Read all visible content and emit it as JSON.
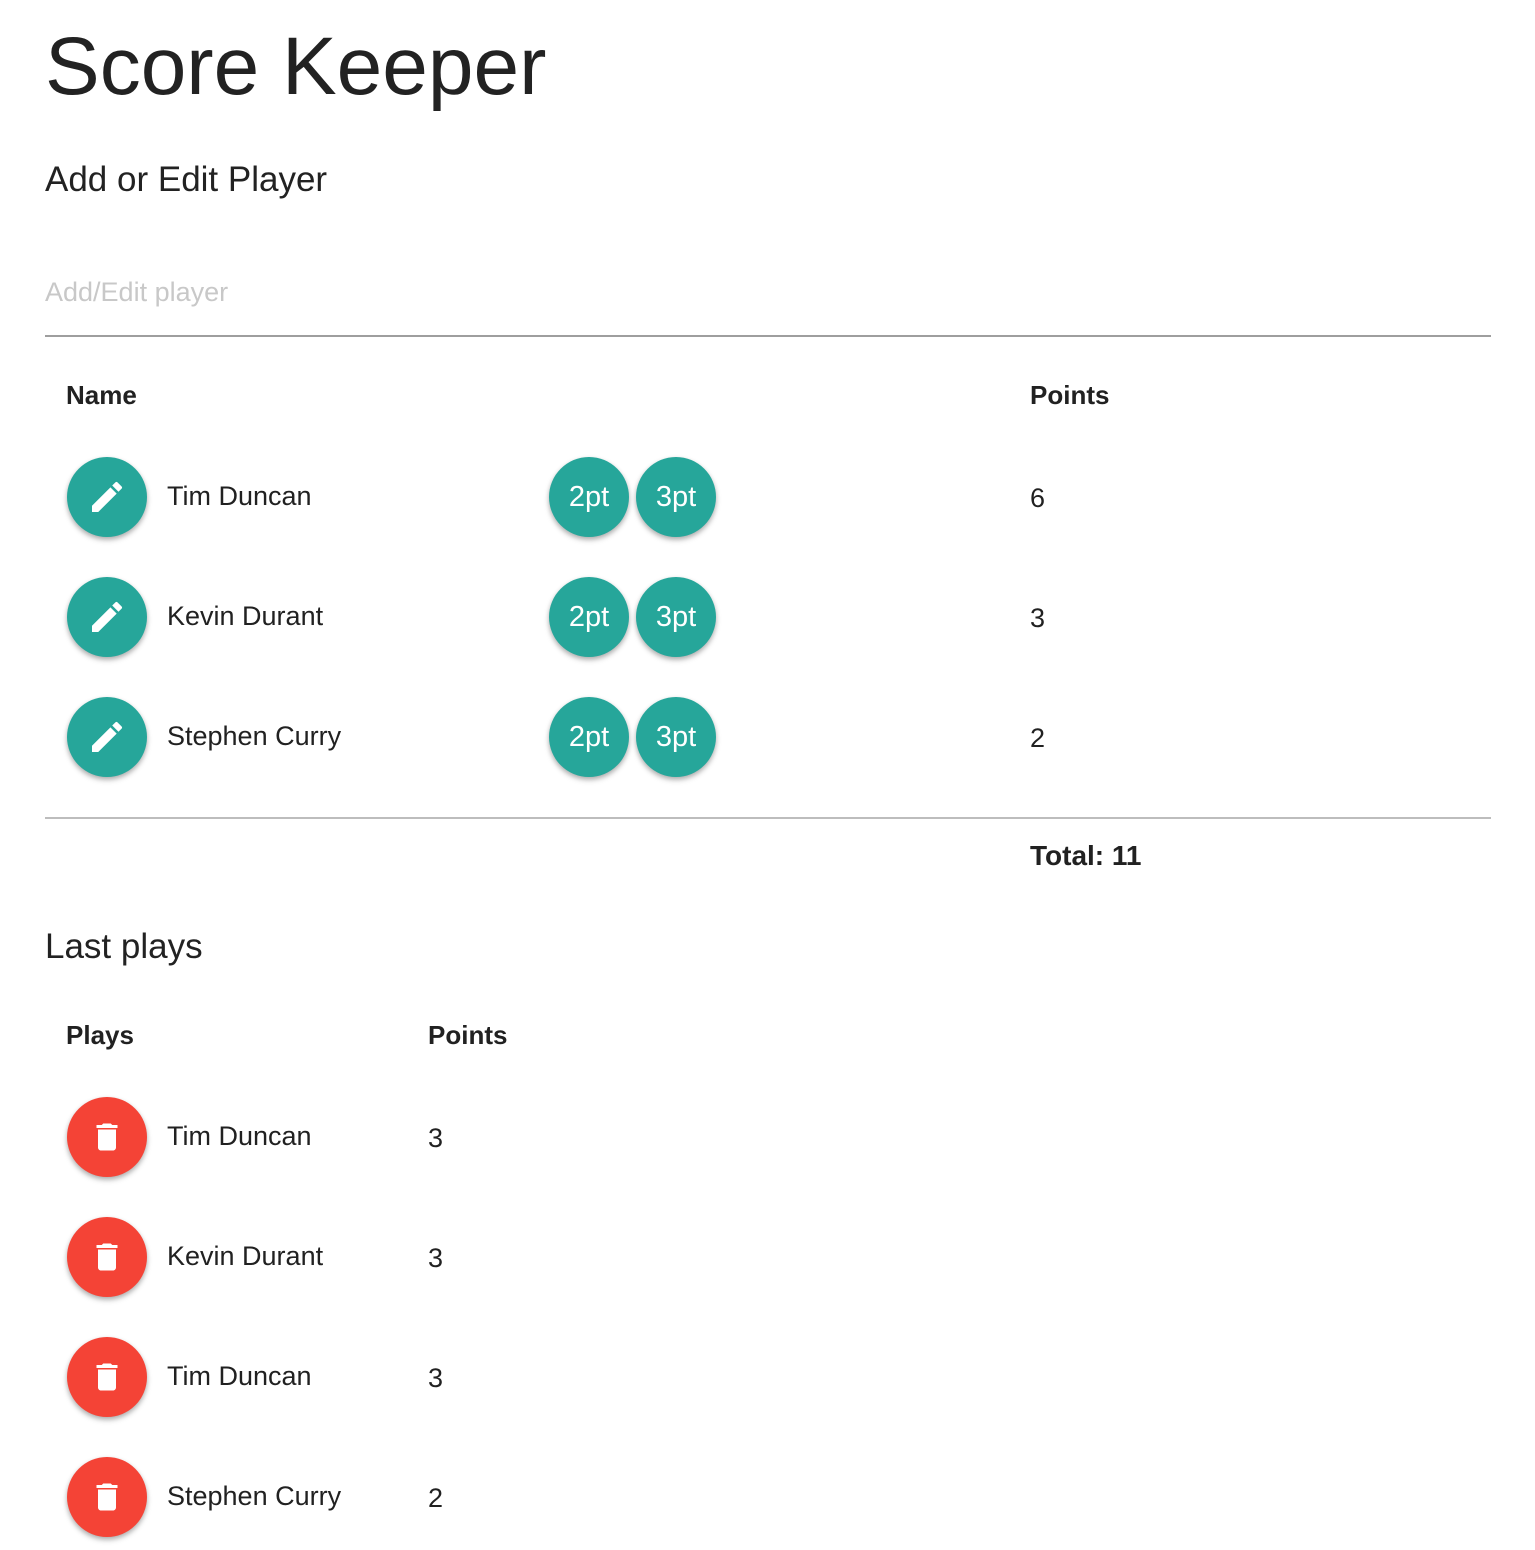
{
  "app": {
    "title": "Score Keeper"
  },
  "player_form": {
    "heading": "Add or Edit Player",
    "placeholder": "Add/Edit player",
    "value": ""
  },
  "scoreboard": {
    "headers": {
      "name": "Name",
      "points": "Points"
    },
    "players": [
      {
        "name": "Tim Duncan",
        "points": "6",
        "btn2": "2pt",
        "btn3": "3pt"
      },
      {
        "name": "Kevin Durant",
        "points": "3",
        "btn2": "2pt",
        "btn3": "3pt"
      },
      {
        "name": "Stephen Curry",
        "points": "2",
        "btn2": "2pt",
        "btn3": "3pt"
      }
    ],
    "total_label": "Total: 11"
  },
  "last_plays": {
    "heading": "Last plays",
    "headers": {
      "plays": "Plays",
      "points": "Points"
    },
    "plays": [
      {
        "player": "Tim Duncan",
        "points": "3"
      },
      {
        "player": "Kevin Durant",
        "points": "3"
      },
      {
        "player": "Tim Duncan",
        "points": "3"
      },
      {
        "player": "Stephen Curry",
        "points": "2"
      }
    ]
  },
  "icons": {
    "edit": "pencil-icon",
    "delete": "trash-icon"
  },
  "colors": {
    "teal": "#26a69a",
    "red": "#f44336"
  }
}
